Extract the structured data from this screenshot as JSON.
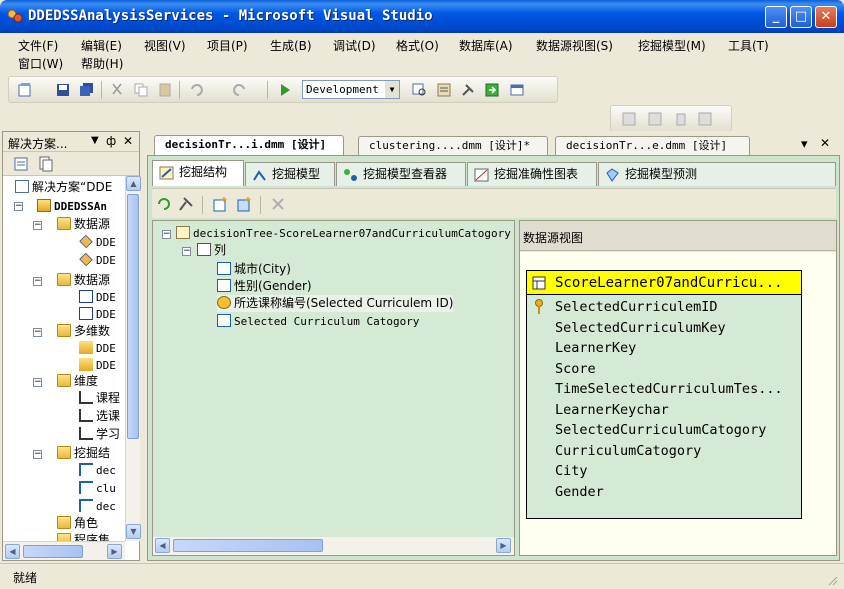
{
  "window": {
    "title": "DDEDSSAnalysisServices - Microsoft Visual Studio",
    "minimize_glyph": "_",
    "maximize_glyph": "□",
    "close_glyph": "✕"
  },
  "menu": {
    "items": [
      "文件(F)",
      "编辑(E)",
      "视图(V)",
      "项目(P)",
      "生成(B)",
      "调试(D)",
      "格式(O)",
      "数据库(A)",
      "数据源视图(S)",
      "挖掘模型(M)",
      "工具(T)",
      "窗口(W)",
      "帮助(H)"
    ]
  },
  "toolbar": {
    "configuration": "Development"
  },
  "solution_explorer": {
    "title": "解决方案...",
    "pin_glyph": "ф",
    "close_glyph": "✕",
    "tree": [
      {
        "label": "解决方案“DDE",
        "icon": "solution-icon"
      },
      {
        "label": "DDEDSSAn",
        "icon": "project-icon"
      },
      {
        "label": "数据源",
        "icon": "folder-icon"
      },
      {
        "label": "DDE",
        "icon": "datasource-icon"
      },
      {
        "label": "DDE",
        "icon": "datasource-icon"
      },
      {
        "label": "数据源",
        "icon": "folder-icon"
      },
      {
        "label": "DDE",
        "icon": "dsv-icon"
      },
      {
        "label": "DDE",
        "icon": "dsv-icon"
      },
      {
        "label": "多维数",
        "icon": "folder-icon"
      },
      {
        "label": "DDE",
        "icon": "cube-icon"
      },
      {
        "label": "DDE",
        "icon": "cube-icon"
      },
      {
        "label": "维度",
        "icon": "folder-icon"
      },
      {
        "label": "课程",
        "icon": "dimension-icon"
      },
      {
        "label": "选课",
        "icon": "dimension-icon"
      },
      {
        "label": "学习",
        "icon": "dimension-icon"
      },
      {
        "label": "挖掘结",
        "icon": "folder-icon"
      },
      {
        "label": "dec",
        "icon": "mining-structure-icon"
      },
      {
        "label": "clu",
        "icon": "mining-structure-icon"
      },
      {
        "label": "dec",
        "icon": "mining-structure-icon"
      },
      {
        "label": "角色",
        "icon": "folder-icon"
      },
      {
        "label": "程序集",
        "icon": "folder-icon"
      }
    ]
  },
  "doc_tabs": [
    {
      "label": "decisionTr...i.dmm [设计]",
      "active": true
    },
    {
      "label": "clustering....dmm [设计]*",
      "active": false
    },
    {
      "label": "decisionTr...e.dmm [设计]",
      "active": false
    }
  ],
  "doc_tab_controls": {
    "dropdown_glyph": "▾",
    "close_glyph": "✕"
  },
  "designer_tabs": [
    {
      "label": "挖掘结构",
      "icon": "mining-structure-icon",
      "active": true
    },
    {
      "label": "挖掘模型",
      "icon": "mining-model-icon",
      "active": false
    },
    {
      "label": "挖掘模型查看器",
      "icon": "model-viewer-icon",
      "active": false
    },
    {
      "label": "挖掘准确性图表",
      "icon": "accuracy-chart-icon",
      "active": false
    },
    {
      "label": "挖掘模型预测",
      "icon": "prediction-icon",
      "active": false
    }
  ],
  "structure_tree": {
    "root": "decisionTree-ScoreLearner07andCurriculumCatogory",
    "columns_label": "列",
    "columns": [
      {
        "label": "城市(City)",
        "key": false
      },
      {
        "label": "性别(Gender)",
        "key": false
      },
      {
        "label": "所选课称编号(Selected Curriculem ID)",
        "key": true
      },
      {
        "label": "Selected Curriculum Catogory",
        "key": false
      }
    ]
  },
  "dsv": {
    "title": "数据源视图",
    "table": {
      "name": "ScoreLearner07andCurricu...",
      "columns": [
        "SelectedCurriculemID",
        "SelectedCurriculumKey",
        "LearnerKey",
        "Score",
        "TimeSelectedCurriculumTes...",
        "LearnerKeychar",
        "SelectedCurriculumCatogory",
        "CurriculumCatogory",
        "City",
        "Gender"
      ]
    }
  },
  "status": {
    "text": "就绪"
  }
}
